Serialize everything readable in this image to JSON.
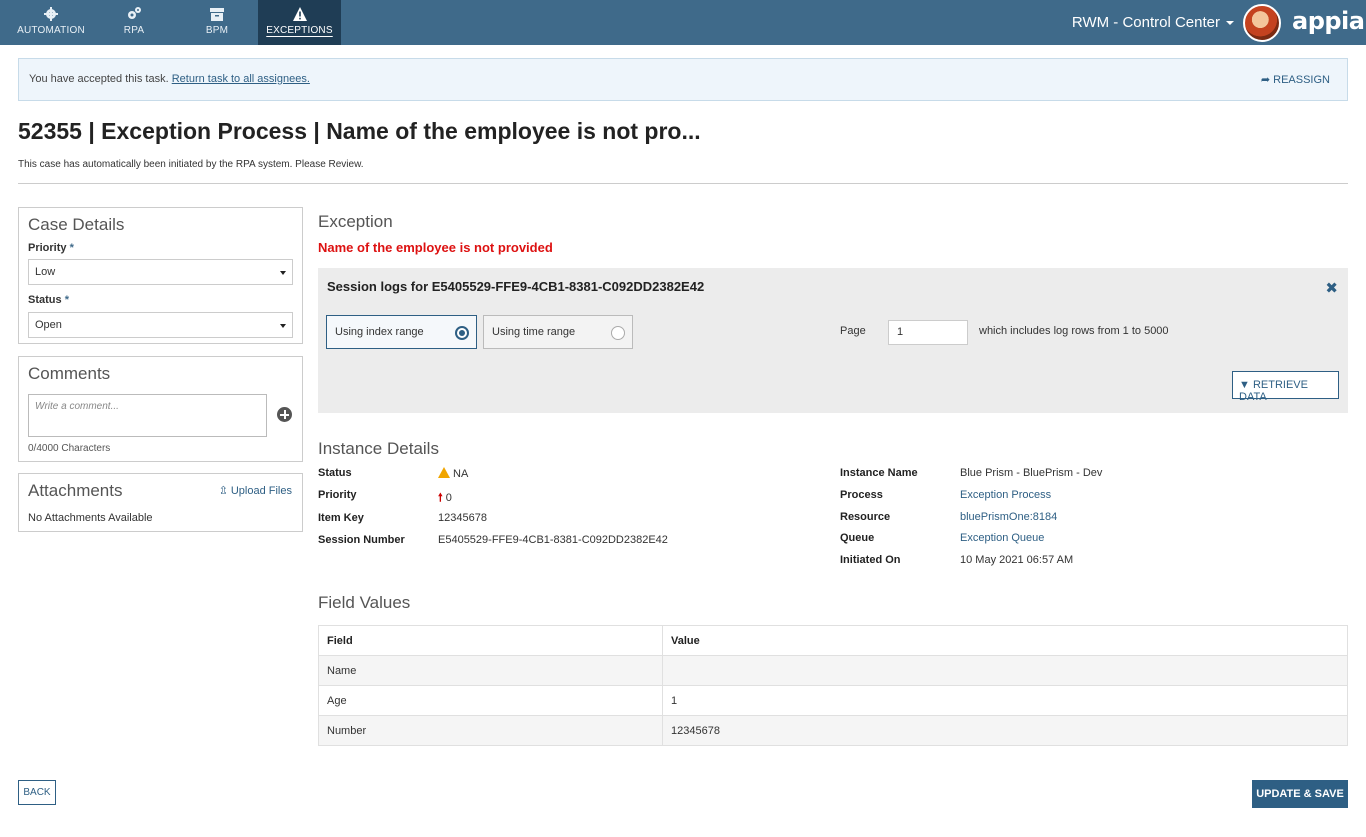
{
  "nav": {
    "tabs": [
      {
        "label": "AUTOMATION",
        "icon": "gear-icon"
      },
      {
        "label": "RPA",
        "icon": "gears-icon"
      },
      {
        "label": "BPM",
        "icon": "archive-box-icon"
      },
      {
        "label": "EXCEPTIONS",
        "icon": "warning-icon",
        "active": true
      }
    ],
    "app_name": "RWM - Control Center",
    "brand": "appian"
  },
  "banner": {
    "message": "You have accepted this task.",
    "return_link": "Return task to all assignees.",
    "reassign": "REASSIGN"
  },
  "page": {
    "title": "52355 | Exception Process | Name of the employee is not pro...",
    "subtitle": "This case has automatically been initiated by the RPA system. Please Review."
  },
  "case_details": {
    "heading": "Case Details",
    "priority_label": "Priority",
    "priority_value": "Low",
    "status_label": "Status",
    "status_value": "Open",
    "required_marker": "*"
  },
  "comments": {
    "heading": "Comments",
    "placeholder": "Write a comment...",
    "char_count": "0/4000 Characters"
  },
  "attachments": {
    "heading": "Attachments",
    "upload_label": "Upload Files",
    "empty_text": "No Attachments Available"
  },
  "exception": {
    "heading": "Exception",
    "error_message": "Name of the employee is not provided",
    "session_logs_title": "Session logs for E5405529-FFE9-4CB1-8381-C092DD2382E42",
    "option_index": "Using index range",
    "option_time": "Using time range",
    "page_label": "Page",
    "page_value": "1",
    "page_note": "which includes log rows from 1 to 5000",
    "retrieve_label": "RETRIEVE DATA"
  },
  "instance": {
    "heading": "Instance Details",
    "left": [
      {
        "key": "Status",
        "value": "NA"
      },
      {
        "key": "Priority",
        "value": "0"
      },
      {
        "key": "Item Key",
        "value": "12345678"
      },
      {
        "key": "Session Number",
        "value": "E5405529-FFE9-4CB1-8381-C092DD2382E42"
      }
    ],
    "right": [
      {
        "key": "Instance Name",
        "value": "Blue Prism - BluePrism - Dev"
      },
      {
        "key": "Process",
        "value": "Exception Process"
      },
      {
        "key": "Resource",
        "value": "bluePrismOne:8184"
      },
      {
        "key": "Queue",
        "value": "Exception Queue"
      },
      {
        "key": "Initiated On",
        "value": "10 May 2021 06:57 AM"
      }
    ]
  },
  "field_values": {
    "heading": "Field Values",
    "columns": [
      "Field",
      "Value"
    ],
    "rows": [
      [
        "Name",
        ""
      ],
      [
        "Age",
        "1"
      ],
      [
        "Number",
        "12345678"
      ]
    ]
  },
  "footer": {
    "back_label": "BACK",
    "save_label": "UPDATE & SAVE"
  },
  "colors": {
    "header_bg": "#3f6a8a",
    "active_tab_bg": "#1f3d55",
    "accent": "#2e5f84",
    "error": "#dd1111",
    "warning": "#f0a500"
  }
}
